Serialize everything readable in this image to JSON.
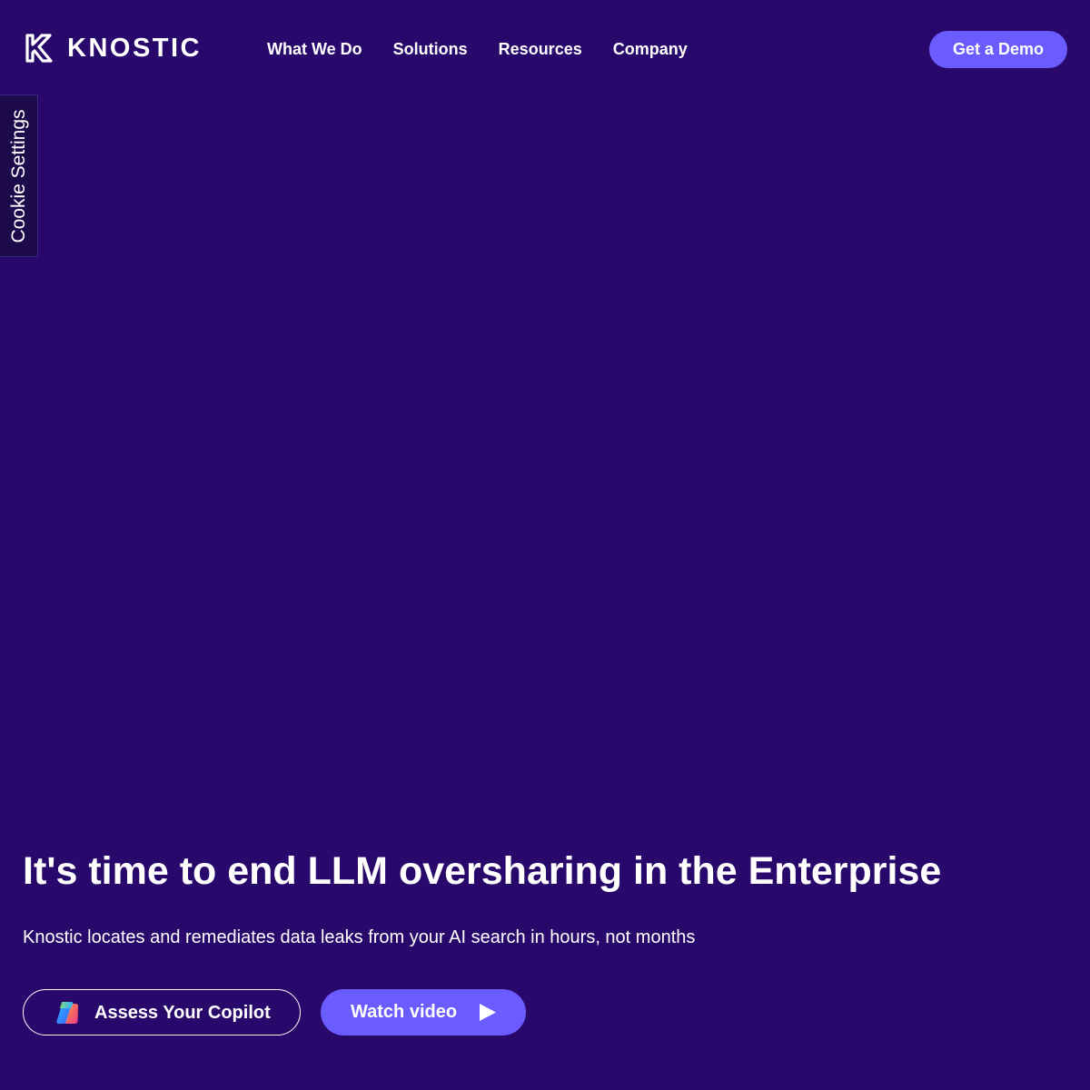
{
  "header": {
    "logo_text": "KNOSTIC",
    "logo_icon": "knostic-logo-icon",
    "nav": [
      {
        "label": "What We Do"
      },
      {
        "label": "Solutions"
      },
      {
        "label": "Resources"
      },
      {
        "label": "Company"
      }
    ],
    "cta_label": "Get a Demo"
  },
  "cookie": {
    "label": "Cookie Settings"
  },
  "hero": {
    "title": "It's time to end LLM oversharing in the Enterprise",
    "subtitle": "Knostic locates and remediates data leaks from your AI search in hours, not months",
    "assess_button": {
      "label": "Assess Your Copilot",
      "icon": "copilot-icon"
    },
    "watch_button": {
      "label": "Watch video",
      "icon": "play-icon"
    }
  },
  "colors": {
    "background": "#28086b",
    "accent": "#6a5cff",
    "text": "#ffffff"
  }
}
